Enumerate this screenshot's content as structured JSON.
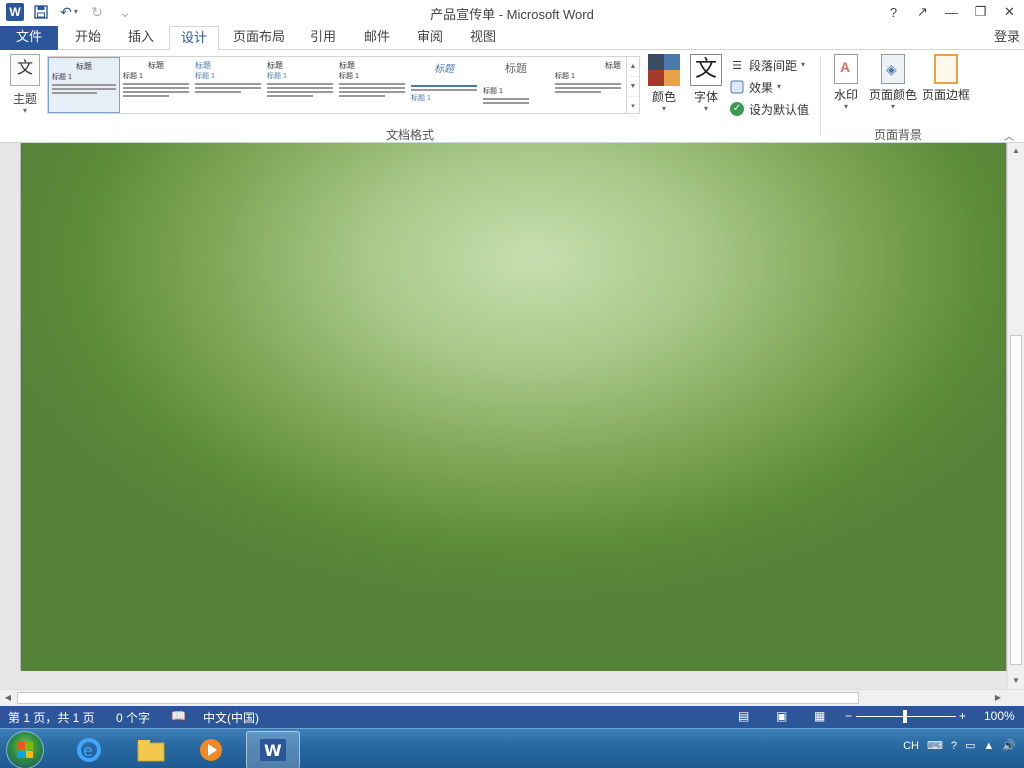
{
  "window": {
    "title": "产品宣传单 - Microsoft Word",
    "help": "?",
    "controls": [
      "↗",
      "—",
      "❐",
      "✕"
    ]
  },
  "qat": {
    "app_icon": "W",
    "save_icon": "save-icon",
    "undo_icon": "undo-icon",
    "redo_icon": "redo-icon",
    "customize": "⌄"
  },
  "tabs": [
    {
      "label": "文件",
      "state": "file"
    },
    {
      "label": "开始",
      "state": "normal"
    },
    {
      "label": "插入",
      "state": "normal"
    },
    {
      "label": "设计",
      "state": "active"
    },
    {
      "label": "页面布局",
      "state": "normal"
    },
    {
      "label": "引用",
      "state": "normal"
    },
    {
      "label": "邮件",
      "state": "normal"
    },
    {
      "label": "审阅",
      "state": "normal"
    },
    {
      "label": "视图",
      "state": "normal"
    }
  ],
  "login": "登录",
  "ribbon": {
    "theme_label": "主题",
    "gallery": [
      {
        "heading": "标题",
        "sub": "标题 1"
      },
      {
        "heading": "标题",
        "sub": "标题 1"
      },
      {
        "heading": "标题",
        "sub": "标题 1"
      },
      {
        "heading": "标题",
        "sub": "标题 1"
      },
      {
        "heading": "标题",
        "sub": "标题 1"
      },
      {
        "heading": "标题",
        "sub": "标题 1"
      },
      {
        "heading": "标题",
        "sub": "标题 1"
      },
      {
        "heading": "标题",
        "sub": "标题 1"
      }
    ],
    "colors_label": "颜色",
    "fonts_label": "字体",
    "fonts_icon": "文",
    "paragraph_spacing": "段落间距",
    "effects": "效果",
    "set_default": "设为默认值",
    "doc_format_group": "文档格式",
    "watermark": "水印",
    "page_color": "页面颜色",
    "page_borders": "页面边框",
    "page_background_group": "页面背景",
    "palette": [
      "#3b4b61",
      "#4a79b0",
      "#a33a2a",
      "#e8a04a"
    ]
  },
  "statusbar": {
    "page": "第 1 页，共 1 页",
    "words": "0 个字",
    "language": "中文(中国)",
    "zoom": "100%",
    "zoom_percent": 100
  },
  "taskbar": {
    "tray_lang": "CH",
    "apps": [
      "ie-icon",
      "explorer-icon",
      "media-player-icon",
      "word-icon"
    ]
  },
  "colors": {
    "accent": "#2b579a",
    "page_bg_center": "#c6dfb0",
    "page_bg_edge": "#55833a"
  }
}
